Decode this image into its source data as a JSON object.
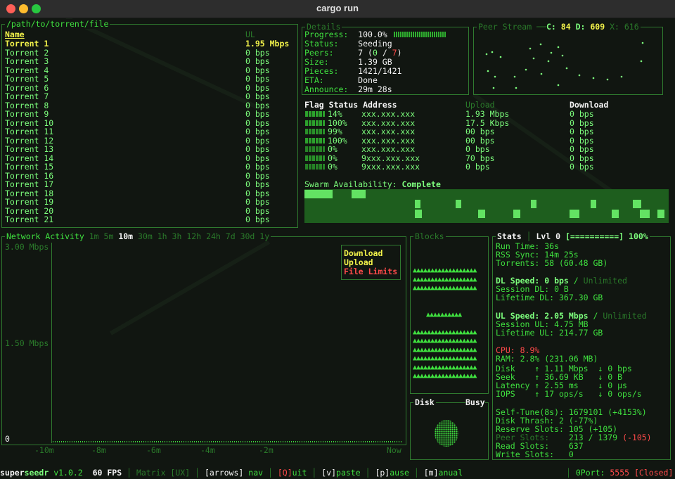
{
  "window": {
    "title": "cargo run"
  },
  "torrents": {
    "path": "/path/to/torrent/file",
    "header_name": "Name",
    "header_col2": "UL",
    "rows": [
      {
        "name": "Torrent 1",
        "rate": "1.95 Mbps"
      },
      {
        "name": "Torrent 2",
        "rate": "0 bps"
      },
      {
        "name": "Torrent 3",
        "rate": "0 bps"
      },
      {
        "name": "Torrent 4",
        "rate": "0 bps"
      },
      {
        "name": "Torrent 5",
        "rate": "0 bps"
      },
      {
        "name": "Torrent 6",
        "rate": "0 bps"
      },
      {
        "name": "Torrent 7",
        "rate": "0 bps"
      },
      {
        "name": "Torrent 8",
        "rate": "0 bps"
      },
      {
        "name": "Torrent 9",
        "rate": "0 bps"
      },
      {
        "name": "Torrent 10",
        "rate": "0 bps"
      },
      {
        "name": "Torrent 11",
        "rate": "0 bps"
      },
      {
        "name": "Torrent 12",
        "rate": "0 bps"
      },
      {
        "name": "Torrent 13",
        "rate": "0 bps"
      },
      {
        "name": "Torrent 14",
        "rate": "0 bps"
      },
      {
        "name": "Torrent 15",
        "rate": "0 bps"
      },
      {
        "name": "Torrent 16",
        "rate": "0 bps"
      },
      {
        "name": "Torrent 17",
        "rate": "0 bps"
      },
      {
        "name": "Torrent 18",
        "rate": "0 bps"
      },
      {
        "name": "Torrent 19",
        "rate": "0 bps"
      },
      {
        "name": "Torrent 20",
        "rate": "0 bps"
      },
      {
        "name": "Torrent 21",
        "rate": "0 bps"
      }
    ]
  },
  "details": {
    "title": "Details",
    "progress_label": "Progress:",
    "progress_value": "100.0%",
    "status_label": "Status:",
    "status_value": "Seeding",
    "peers_label": "Peers:",
    "peers_a": "7 (",
    "peers_b": "0",
    "peers_c": " / ",
    "peers_d": "7",
    "peers_e": ")",
    "size_label": "Size:",
    "size_value": "1.39 GB",
    "pieces_label": "Pieces:",
    "pieces_value": "1421/1421",
    "eta_label": "ETA:",
    "eta_value": "Done",
    "announce_label": "Announce:",
    "announce_value": "29m 28s"
  },
  "peer_stream": {
    "title": "Peer Stream",
    "c_label": "C:",
    "c_value": "84",
    "d_label": "D:",
    "d_value": "609",
    "x_label": "X:",
    "x_value": "616"
  },
  "peers_table": {
    "headers": [
      "Flag",
      "Status",
      "Address",
      "Upload",
      "Download"
    ],
    "rows": [
      {
        "status": "14%",
        "address": "xxx.xxx.xxx",
        "upload": "1.93 Mbps",
        "download": "0 bps"
      },
      {
        "status": "100%",
        "address": "xxx.xxx.xxx",
        "upload": "17.5 Kbps",
        "download": "0 bps"
      },
      {
        "status": "99%",
        "address": "xxx.xxx.xxx",
        "upload": "00 bps",
        "download": "0 bps"
      },
      {
        "status": "100%",
        "address": "xxx.xxx.xxx",
        "upload": "00 bps",
        "download": "0 bps"
      },
      {
        "status": "0%",
        "address": "xxx.xxx.xxx",
        "upload": "0 bps",
        "download": "0 bps"
      },
      {
        "status": "0%",
        "address": "9xxx.xxx.xxx",
        "upload": "70 bps",
        "download": "0 bps"
      },
      {
        "status": "0%",
        "address": "9xxx.xxx.xxx",
        "upload": "0 bps",
        "download": "0 bps"
      }
    ],
    "swarm_label": "Swarm Availability:",
    "swarm_value": "Complete"
  },
  "network": {
    "title": "Network Activity",
    "ranges": [
      "1m",
      "5m",
      "10m",
      "30m",
      "1h",
      "3h",
      "12h",
      "24h",
      "7d",
      "30d",
      "1y"
    ],
    "active_range": "10m",
    "y_top": "3.00 Mbps",
    "y_mid": "1.50 Mbps",
    "y_bottom": "0",
    "x_labels": [
      "-10m",
      "-8m",
      "-6m",
      "-4m",
      "-2m",
      "Now"
    ],
    "legend_download": "Download",
    "legend_upload": "Upload",
    "legend_limits": "File Limits"
  },
  "blocks": {
    "title": "Blocks"
  },
  "disk": {
    "title": "Disk",
    "busy": "Busy"
  },
  "stats": {
    "title": "Stats",
    "level": "Lvl 0",
    "level_bar": "[==========]",
    "level_pct": "100%",
    "run_time": "Run Time: 36s",
    "rss_sync": "RSS Sync: 14m 25s",
    "torrents": "Torrents: 58 (60.48 GB)",
    "dl_speed_label": "DL Speed: 0 bps",
    "dl_limit": "Unlimited",
    "session_dl": "Session DL: 0 B",
    "lifetime_dl": "Lifetime DL: 367.30 GB",
    "ul_speed_label": "UL Speed: 2.05 Mbps",
    "ul_limit": "Unlimited",
    "session_ul": "Session UL: 4.75 MB",
    "lifetime_ul": "Lifetime UL: 214.77 GB",
    "cpu": "CPU: 8.9%",
    "ram": "RAM: 2.8% (231.06 MB)",
    "disk_row": "Disk    ↑ 1.11 Mbps  ↓ 0 bps",
    "seek_row": "Seek    ↑ 36.69 KB   ↓ 0 B",
    "latency_row": "Latency ↑ 2.55 ms    ↓ 0 µs",
    "iops_row": "IOPS    ↑ 17 ops/s   ↓ 0 ops/s",
    "self_tune": "Self-Tune(8s): 1679101 (+4153%)",
    "disk_thrash": "Disk Thrash: 2 (-77%)",
    "reserve_slots": "Reserve Slots: 105 (+105)",
    "peer_slots_label": "Peer Slots:",
    "peer_slots_value": "213 / 1379",
    "peer_slots_delta": "(-105)",
    "read_slots": "Read Slots:    637",
    "write_slots": "Write Slots:   0"
  },
  "statusbar": {
    "app_a": "super",
    "app_b": "seedr",
    "version": "v1.0.2",
    "fps": "60 FPS",
    "mode": "Matrix [UX]",
    "arrows": "[arrows]",
    "nav": "nav",
    "quit_key": "[Q]",
    "quit": "uit",
    "paste_key": "[v]",
    "paste": "paste",
    "pause_key": "[p]",
    "pause": "ause",
    "manual_key": "[m]",
    "manual": "anual",
    "port_label": "0Port:",
    "port_value": "5555",
    "port_state": "[Closed]"
  },
  "colors": {
    "bg": "#111611",
    "green": "#3fe03f",
    "bright": "#7dff7d",
    "yellow": "#f2f24a",
    "red": "#ff4a4a",
    "border": "#2f7a2f"
  }
}
